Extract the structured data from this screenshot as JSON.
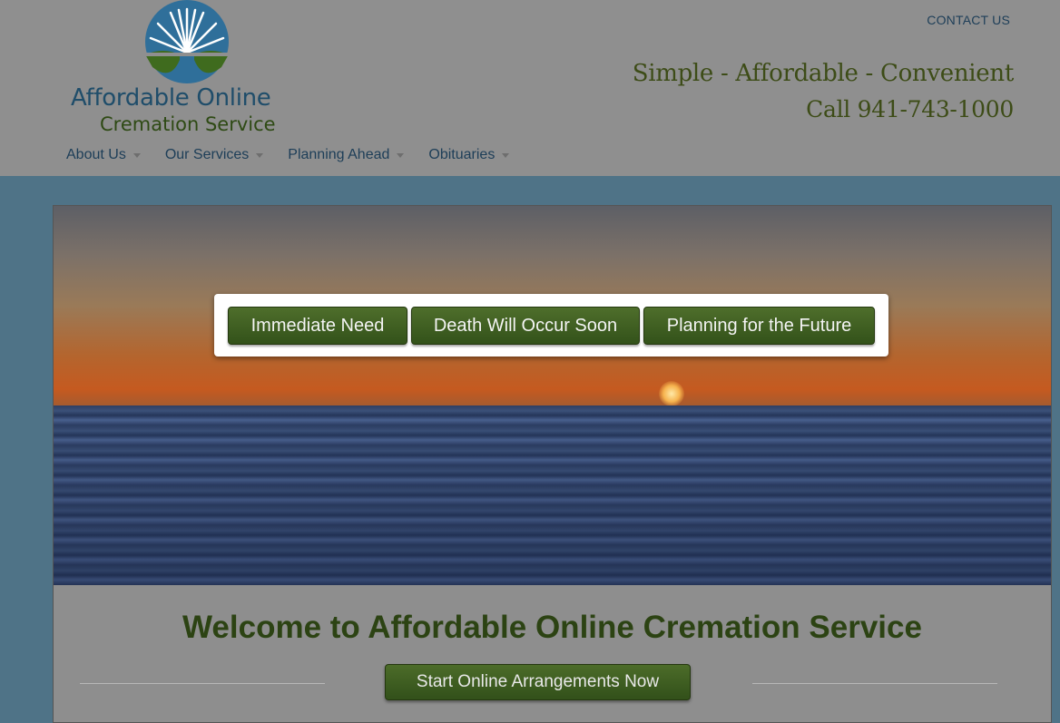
{
  "header": {
    "logo": {
      "line1": "Affordable Online",
      "line2": "Cremation Service"
    },
    "contact_label": "CONTACT US",
    "tagline": "Simple - Affordable - Convenient",
    "phone": "Call 941-743-1000"
  },
  "nav": {
    "items": [
      {
        "label": "About Us"
      },
      {
        "label": "Our Services"
      },
      {
        "label": "Planning Ahead"
      },
      {
        "label": "Obituaries"
      }
    ]
  },
  "hero": {
    "buttons": [
      {
        "label": "Immediate Need"
      },
      {
        "label": "Death Will Occur Soon"
      },
      {
        "label": "Planning for the Future"
      }
    ]
  },
  "main": {
    "welcome_title": "Welcome to Affordable Online Cremation Service",
    "start_button": "Start Online Arrangements Now"
  },
  "colors": {
    "brand_green": "#33521a",
    "brand_blue": "#1f4d6a",
    "page_background": "#4f7387"
  }
}
